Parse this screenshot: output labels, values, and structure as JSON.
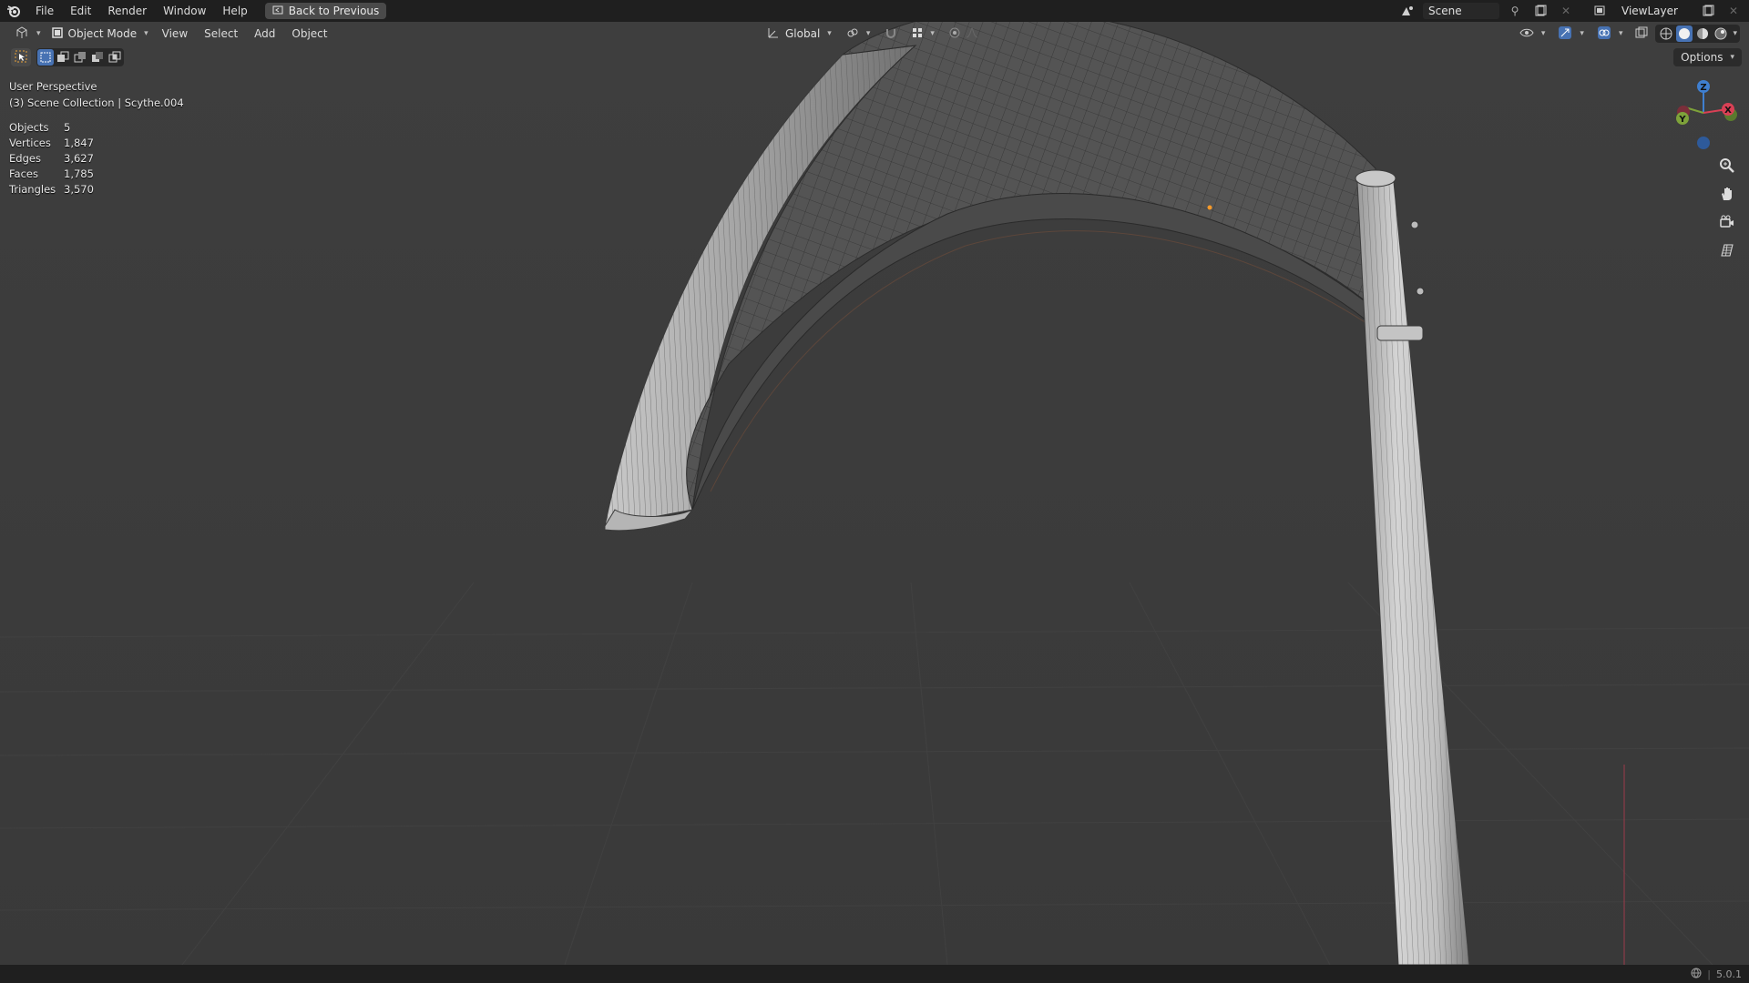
{
  "topbar": {
    "menus": [
      "File",
      "Edit",
      "Render",
      "Window",
      "Help"
    ],
    "back_label": "Back to Previous",
    "scene_name": "Scene",
    "view_layer": "ViewLayer"
  },
  "header": {
    "mode": "Object Mode",
    "menus": [
      "View",
      "Select",
      "Add",
      "Object"
    ],
    "transform_orientation": "Global",
    "options_label": "Options"
  },
  "overlay": {
    "view_name": "User Perspective",
    "collection_path": "(3) Scene Collection | Scythe.004"
  },
  "stats": [
    {
      "label": "Objects",
      "value": "5"
    },
    {
      "label": "Vertices",
      "value": "1,847"
    },
    {
      "label": "Edges",
      "value": "3,627"
    },
    {
      "label": "Faces",
      "value": "1,785"
    },
    {
      "label": "Triangles",
      "value": "3,570"
    }
  ],
  "gizmo": {
    "z": "Z",
    "y": "Y",
    "x": "X"
  },
  "status": {
    "version": "5.0.1"
  },
  "colors": {
    "accent": "#4772b3",
    "background": "#3d3d3d",
    "bar": "#1f1f1f",
    "axis_x": "#d94055",
    "axis_y": "#7ea23a",
    "axis_z": "#3f7fd0"
  },
  "icons": {
    "app": "blender-logo-icon",
    "navigation": [
      "zoom-icon",
      "hand-pan-icon",
      "camera-icon",
      "grid-ortho-icon"
    ]
  }
}
